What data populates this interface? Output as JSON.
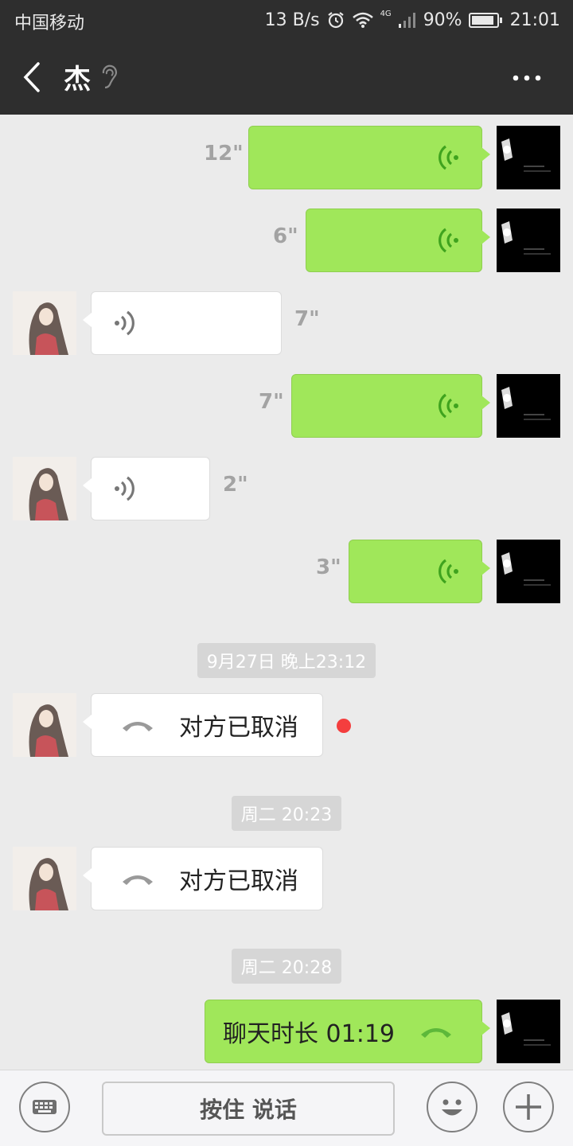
{
  "status_bar": {
    "carrier": "中国移动",
    "net_speed": "13 B/s",
    "network": "4G",
    "battery": "90%",
    "battery_level": 0.9,
    "time": "21:01"
  },
  "header": {
    "title": "杰"
  },
  "messages": {
    "m1": {
      "duration": "12\""
    },
    "m2": {
      "duration": "6\""
    },
    "m3": {
      "duration": "7\""
    },
    "m4": {
      "duration": "7\""
    },
    "m5": {
      "duration": "2\""
    },
    "m6": {
      "duration": "3\""
    },
    "ts1": "9月27日 晚上23:12",
    "call1": {
      "text": "对方已取消"
    },
    "ts2": "周二 20:23",
    "call2": {
      "text": "对方已取消"
    },
    "ts3": "周二 20:28",
    "call3": {
      "text": "聊天时长 01:19"
    }
  },
  "input_bar": {
    "hold_to_talk": "按住 说话"
  },
  "colors": {
    "outgoing_bubble": "#a0e75a",
    "incoming_bubble": "#ffffff",
    "header_bg": "#2e2e2e",
    "chat_bg": "#ebebeb",
    "unread_dot": "#f43e3e"
  }
}
